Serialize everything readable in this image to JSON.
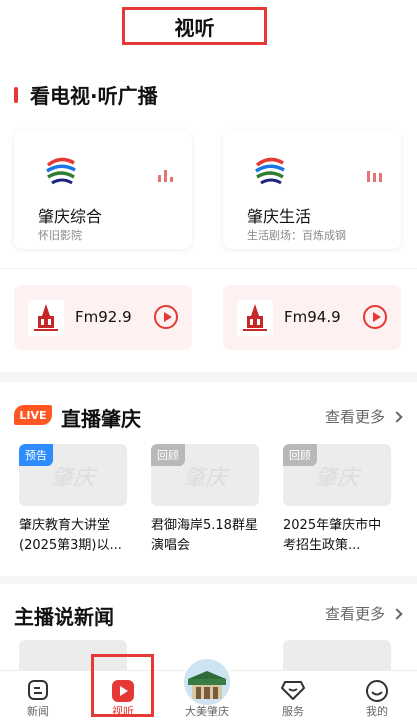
{
  "header": {
    "title": "视听"
  },
  "sections": {
    "tv_radio": {
      "title": "看电视·听广播"
    },
    "live": {
      "badge": "LIVE",
      "title": "直播肇庆",
      "more": "查看更多"
    },
    "anchor": {
      "title": "主播说新闻",
      "more": "查看更多"
    }
  },
  "tv_channels": [
    {
      "name": "肇庆综合",
      "sub": "怀旧影院"
    },
    {
      "name": "肇庆生活",
      "sub": "生活剧场：百炼成钢"
    }
  ],
  "radio_channels": [
    {
      "name": "Fm92.9"
    },
    {
      "name": "Fm94.9"
    }
  ],
  "live_items": [
    {
      "tag": "预告",
      "watermark": "肇庆",
      "title": "肇庆教育大讲堂(2025第3期)以..."
    },
    {
      "tag": "回顾",
      "watermark": "肇庆",
      "title": "君御海岸5.18群星演唱会"
    },
    {
      "tag": "回顾",
      "watermark": "肇庆",
      "title": "2025年肇庆市中考招生政策..."
    }
  ],
  "tabbar": {
    "items": [
      {
        "label": "新闻",
        "icon": "news-icon"
      },
      {
        "label": "视听",
        "icon": "play-icon"
      },
      {
        "label": "大美肇庆",
        "icon": "landmark-avatar"
      },
      {
        "label": "服务",
        "icon": "diamond-icon"
      },
      {
        "label": "我的",
        "icon": "smile-icon"
      }
    ]
  },
  "colors": {
    "accent": "#e53935",
    "live_badge": "#ff5722",
    "tag_blue": "#2f8cff",
    "tag_grey": "#b8b8b8"
  }
}
